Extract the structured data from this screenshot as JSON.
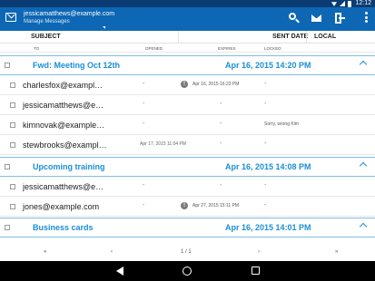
{
  "status_bar": {
    "time": "12:12"
  },
  "app_bar": {
    "account": "jessicamatthews@example.com",
    "subtitle": "Manage Messages"
  },
  "columns": {
    "subject": "SUBJECT",
    "sent_date": "SENT DATE",
    "local": "LOCAL",
    "to": "TO",
    "opened": "OPENED",
    "expires": "EXPIRES",
    "locked": "LOCKED"
  },
  "groups": [
    {
      "title": "Fwd: Meeting Oct 12th",
      "date": "Apr 16, 2015 14:20 PM",
      "rows": [
        {
          "to": "charlesfox@exampl…",
          "opened": "-",
          "warn": true,
          "expires": "Apr 16, 2015 16:23 PM",
          "locked": "-"
        },
        {
          "to": "jessicamatthews@e…",
          "opened": "-",
          "warn": false,
          "expires": "-",
          "locked": "-"
        },
        {
          "to": "kimnovak@example…",
          "opened": "-",
          "warn": false,
          "expires": "-",
          "locked": "Sorry, wrong Kim"
        },
        {
          "to": "stewbrooks@exampl…",
          "opened": "Apr 17, 2015 11:04 PM",
          "warn": false,
          "expires": "-",
          "locked": "-"
        }
      ]
    },
    {
      "title": "Upcoming training",
      "date": "Apr 16, 2015 14:08 PM",
      "rows": [
        {
          "to": "jessicamatthews@e…",
          "opened": "-",
          "warn": false,
          "expires": "-",
          "locked": "-"
        },
        {
          "to": "jones@example.com",
          "opened": "-",
          "warn": true,
          "expires": "Apr 27, 2015 15:11 PM",
          "locked": "-"
        }
      ]
    },
    {
      "title": "Business cards",
      "date": "Apr 16, 2015 14:01 PM",
      "rows": []
    }
  ],
  "pager": {
    "first": "«",
    "prev": "‹",
    "page": "1 / 1",
    "next": "›",
    "last": "»"
  },
  "warn_glyph": "!"
}
